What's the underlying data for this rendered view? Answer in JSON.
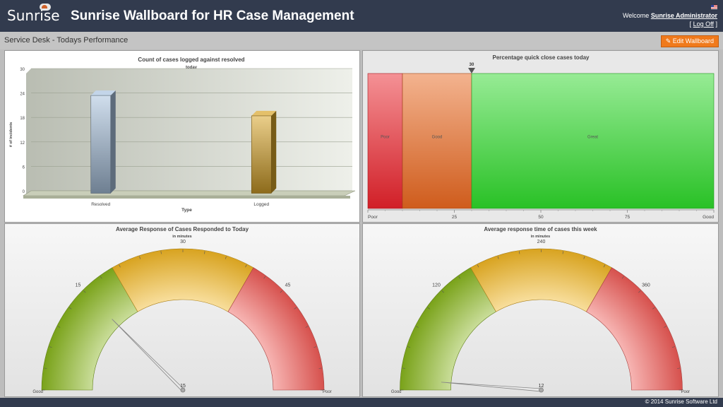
{
  "header": {
    "logo_text": "Sunrise",
    "title": "Sunrise Wallboard for HR Case Management",
    "welcome_prefix": "Welcome",
    "user_name": "Sunrise Administrator",
    "logoff_open": "[",
    "logoff_label": "Log Off",
    "logoff_close": "]"
  },
  "subbar": {
    "title": "Service Desk - Todays Performance",
    "edit_label": "Edit Wallboard"
  },
  "footer": {
    "copyright": "© 2014 Sunrise Software Ltd"
  },
  "chart_data": [
    {
      "type": "bar",
      "title": "Count of cases logged against resolved",
      "subtitle": "today",
      "xlabel": "Type",
      "ylabel": "# of incidents",
      "categories": [
        "Resolved",
        "Logged"
      ],
      "values": [
        24,
        19
      ],
      "ylim": [
        0,
        30
      ],
      "yticks": [
        0,
        6,
        12,
        18,
        24,
        30
      ],
      "colors": [
        "#a9c3df",
        "#d9a52a"
      ]
    },
    {
      "type": "bar",
      "title": "Percentage quick close cases today",
      "value": 30,
      "value_label": "30",
      "ranges": [
        {
          "label": "Poor",
          "from": 0,
          "to": 10,
          "color": "#e8222b"
        },
        {
          "label": "Good",
          "from": 10,
          "to": 30,
          "color": "#e6661f"
        },
        {
          "label": "Great",
          "from": 30,
          "to": 100,
          "color": "#2ed62a"
        }
      ],
      "ticks": [
        "Poor",
        "25",
        "50",
        "75",
        "Good"
      ],
      "tick_values": [
        0,
        25,
        50,
        75,
        100
      ]
    },
    {
      "type": "pie",
      "title": "Average Response of Cases Responded to Today",
      "subtitle": "in minutes",
      "min": 0,
      "max": 60,
      "value": 15,
      "value_label": "15",
      "min_label": "Good",
      "max_label": "Poor",
      "tick_labels": [
        {
          "v": 15,
          "t": "15"
        },
        {
          "v": 30,
          "t": "30"
        },
        {
          "v": 45,
          "t": "45"
        }
      ],
      "ranges": [
        {
          "from": 0,
          "to": 20,
          "color": "#86b41c"
        },
        {
          "from": 20,
          "to": 40,
          "color": "#f0b524"
        },
        {
          "from": 40,
          "to": 60,
          "color": "#ee5a56"
        }
      ]
    },
    {
      "type": "pie",
      "title": "Average response time of cases this week",
      "subtitle": "in minutes",
      "min": 0,
      "max": 480,
      "value": 12,
      "value_label": "12",
      "min_label": "Good",
      "max_label": "Poor",
      "tick_labels": [
        {
          "v": 120,
          "t": "120"
        },
        {
          "v": 240,
          "t": "240"
        },
        {
          "v": 360,
          "t": "360"
        }
      ],
      "ranges": [
        {
          "from": 0,
          "to": 160,
          "color": "#86b41c"
        },
        {
          "from": 160,
          "to": 320,
          "color": "#f0b524"
        },
        {
          "from": 320,
          "to": 480,
          "color": "#ee5a56"
        }
      ]
    }
  ]
}
